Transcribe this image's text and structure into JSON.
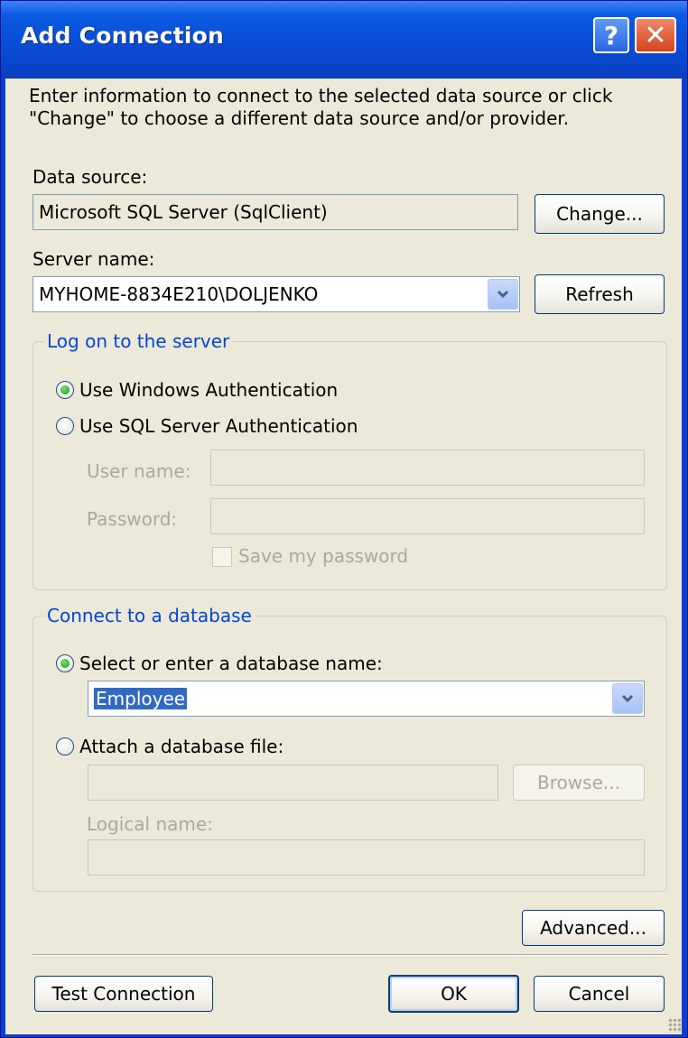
{
  "window": {
    "title": "Add Connection",
    "help_glyph": "?",
    "close_glyph": "✕"
  },
  "description": "Enter information to connect to the selected data source or click \"Change\" to choose a different data source and/or provider.",
  "data_source": {
    "label": "Data source:",
    "value": "Microsoft SQL Server (SqlClient)",
    "change_label": "Change..."
  },
  "server": {
    "label": "Server name:",
    "value": "MYHOME-8834E210\\DOLJENKO",
    "refresh_label": "Refresh"
  },
  "logon": {
    "group_title": "Log on to the server",
    "windows_auth_label": "Use Windows Authentication",
    "windows_auth_selected": true,
    "sql_auth_label": "Use SQL Server Authentication",
    "sql_auth_selected": false,
    "username_label": "User name:",
    "username_value": "",
    "password_label": "Password:",
    "password_value": "",
    "save_password_label": "Save my password",
    "save_password_checked": false
  },
  "database": {
    "group_title": "Connect to a database",
    "select_label": "Select or enter a database name:",
    "select_selected": true,
    "db_name_value": "Employee",
    "attach_label": "Attach a database file:",
    "attach_selected": false,
    "file_value": "",
    "browse_label": "Browse...",
    "logical_name_label": "Logical name:",
    "logical_name_value": ""
  },
  "buttons": {
    "advanced": "Advanced...",
    "test_connection": "Test Connection",
    "ok": "OK",
    "cancel": "Cancel"
  },
  "colors": {
    "title_bar": "#0a4cd6",
    "dialog_bg": "#ece9d8",
    "group_title_text": "#0046d5",
    "selection": "#316ac5"
  }
}
